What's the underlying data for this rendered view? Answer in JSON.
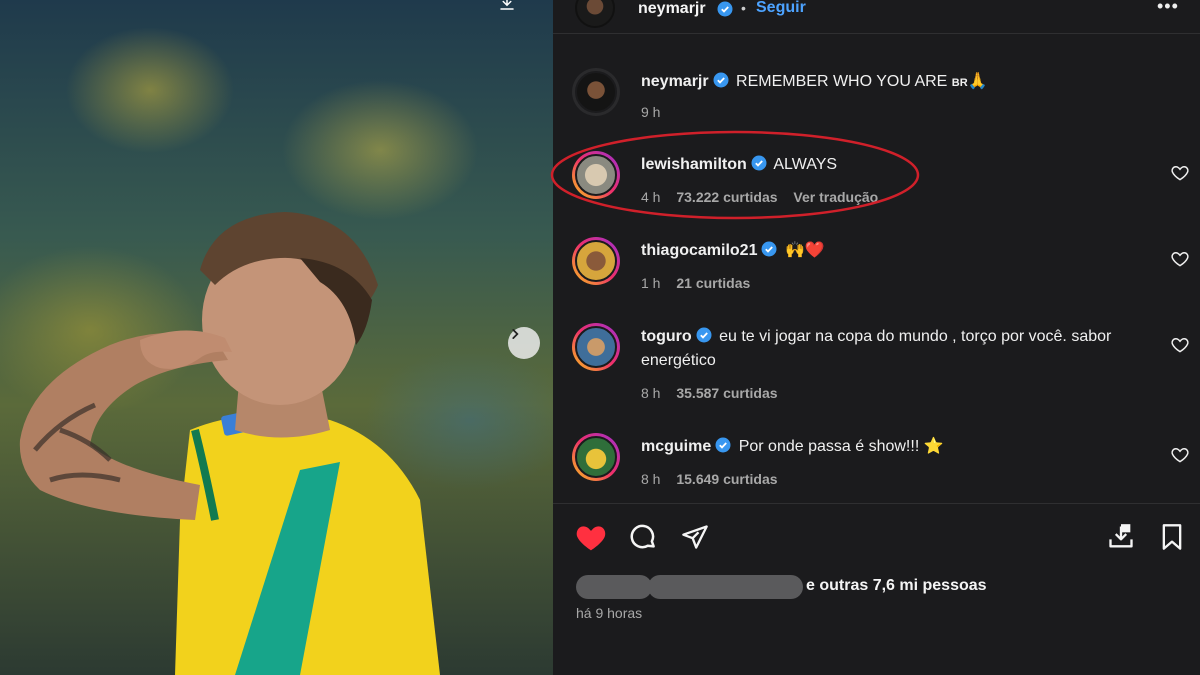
{
  "header": {
    "username": "neymarjr",
    "separator": "•",
    "follow_label": "Seguir",
    "more_label": "•••"
  },
  "caption": {
    "username": "neymarjr",
    "text": "REMEMBER WHO YOU ARE",
    "flag": "BR",
    "emoji": "🙏",
    "time": "9 h"
  },
  "comments": [
    {
      "username": "lewishamilton",
      "text": "ALWAYS",
      "time": "4 h",
      "likes": "73.222 curtidas",
      "translate": "Ver tradução",
      "highlighted": true
    },
    {
      "username": "thiagocamilo21",
      "text": "🙌❤️",
      "time": "1 h",
      "likes": "21 curtidas"
    },
    {
      "username": "toguro",
      "text": "eu te vi jogar na copa do mundo , torço por você. sabor energético",
      "time": "8 h",
      "likes": "35.587 curtidas"
    },
    {
      "username": "mcguime",
      "text": "Por onde passa é show!!! ⭐",
      "time": "8 h",
      "likes": "15.649 curtidas"
    }
  ],
  "footer": {
    "likes_text": "e outras 7,6 mi pessoas",
    "time_ago": "há 9 horas"
  },
  "icons": {
    "like": "heart-filled-icon",
    "comment": "comment-bubble-icon",
    "share": "paper-plane-icon",
    "save_download": "download-icon",
    "bookmark": "bookmark-icon"
  },
  "colors": {
    "panel_bg": "#1b1b1d",
    "link_blue": "#4da3ff",
    "verified_blue": "#3897f0",
    "like_red": "#ff3040",
    "highlight_red": "#d0202a"
  }
}
